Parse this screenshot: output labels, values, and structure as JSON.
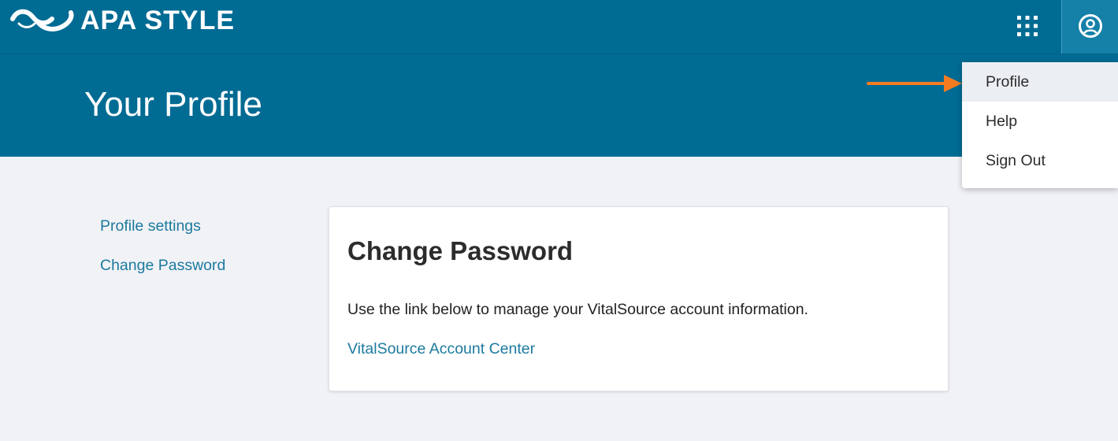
{
  "header": {
    "brand": "APA STYLE",
    "apps_icon": "grid-icon",
    "account_icon": "user-circle-icon",
    "bg_color": "#006b93"
  },
  "hero": {
    "title": "Your Profile"
  },
  "sidebar": {
    "items": [
      {
        "label": "Profile settings"
      },
      {
        "label": "Change Password"
      }
    ]
  },
  "card": {
    "title": "Change Password",
    "description": "Use the link below to manage your VitalSource account information.",
    "link_label": "VitalSource Account Center"
  },
  "account_menu": {
    "items": [
      {
        "label": "Profile",
        "active": true
      },
      {
        "label": "Help"
      },
      {
        "label": "Sign Out"
      }
    ]
  },
  "annotation": {
    "arrow_color": "#f47c20",
    "arrow_icon": "arrow-right-icon"
  },
  "colors": {
    "link": "#1c7a9e",
    "page_bg": "#f1f2f6"
  }
}
